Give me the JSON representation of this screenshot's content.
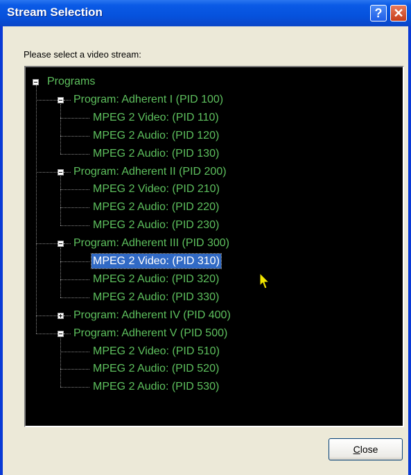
{
  "window": {
    "title": "Stream Selection",
    "help_button": "?",
    "close_button": "✕"
  },
  "prompt": "Please select a video stream:",
  "tree": {
    "root": "Programs",
    "programs": [
      {
        "label": "Program: Adherent I (PID 100)",
        "expanded": true,
        "streams": [
          "MPEG 2 Video: (PID 110)",
          "MPEG 2 Audio: (PID 120)",
          "MPEG 2 Audio: (PID 130)"
        ]
      },
      {
        "label": "Program: Adherent II (PID 200)",
        "expanded": true,
        "streams": [
          "MPEG 2 Video: (PID 210)",
          "MPEG 2 Audio: (PID 220)",
          "MPEG 2 Audio: (PID 230)"
        ]
      },
      {
        "label": "Program: Adherent III (PID 300)",
        "expanded": true,
        "streams": [
          "MPEG 2 Video: (PID 310)",
          "MPEG 2 Audio: (PID 320)",
          "MPEG 2 Audio: (PID 330)"
        ]
      },
      {
        "label": "Program: Adherent IV (PID 400)",
        "expanded": false,
        "streams": []
      },
      {
        "label": "Program: Adherent V (PID 500)",
        "expanded": true,
        "streams": [
          "MPEG 2 Video: (PID 510)",
          "MPEG 2 Audio: (PID 520)",
          "MPEG 2 Audio: (PID 530)"
        ]
      }
    ],
    "selected": "MPEG 2 Video: (PID 310)"
  },
  "buttons": {
    "close_mnemonic": "C",
    "close_rest": "lose"
  },
  "colors": {
    "tree_background": "#000000",
    "tree_text": "#5ec15e",
    "selection": "#316ac5",
    "titlebar": "#0652dd"
  }
}
